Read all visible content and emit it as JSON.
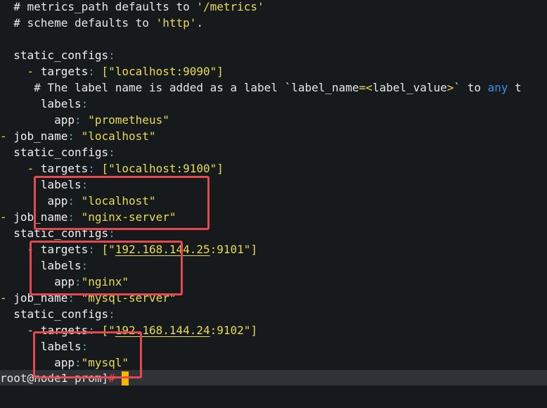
{
  "terminal": {
    "lines": [
      {
        "c1": "  # metrics_path defaults to ",
        "c2": "'/metrics'"
      },
      {
        "c1": "  # scheme defaults to ",
        "c2": "'http'",
        "c3": "."
      },
      {},
      {
        "k": "  static_configs",
        "colon": ":"
      },
      {
        "dash": "    - ",
        "k": "targets",
        "colon": ":",
        "v": " [\"localhost:9090\"]"
      },
      {
        "c1": "     # The label name is added as a label `label_name",
        "eq": "=<",
        "c3": "label_value",
        "gt": ">",
        "c4": "` to ",
        "kw": "any",
        "c5": " t"
      },
      {
        "k": "      labels",
        "colon": ":"
      },
      {
        "k": "        app",
        "colon": ":",
        "v": " \"prometheus\""
      },
      {
        "dash": "- ",
        "k": "job_name",
        "colon": ":",
        "v": " \"localhost\""
      },
      {
        "k": "  static_configs",
        "colon": ":"
      },
      {
        "dash": "    - ",
        "k": "targets",
        "colon": ":",
        "v": " [\"localhost:9100\"]"
      },
      {
        "k": "      labels",
        "colon": ":"
      },
      {
        "k": "       app",
        "colon": ":",
        "v": " \"localhost\""
      },
      {
        "dash": "- ",
        "k": "job_name",
        "colon": ":",
        "v": " \"nginx-server\""
      },
      {
        "k": "  static_configs",
        "colon": ":"
      },
      {
        "dash": "    - ",
        "k": "targets",
        "colon": ":",
        "v1": " [\"",
        "ip": "192.168.144.25",
        "v2": ":9101\"]"
      },
      {
        "k": "      labels",
        "colon": ":"
      },
      {
        "k": "        app",
        "colon": ":",
        "v": "\"nginx\""
      },
      {
        "dash": "- ",
        "k": "job_name",
        "colon": ":",
        "v": " \"mysql-server\""
      },
      {
        "k": "  static_configs",
        "colon": ":"
      },
      {
        "dash": "    - ",
        "k": "targets",
        "colon": ":",
        "v1": " [\"",
        "ip": "192.168.144.24",
        "v2": ":9102\"]"
      },
      {
        "k": "      labels",
        "colon": ":"
      },
      {
        "k": "        app",
        "colon": ":",
        "v": "\"mysql\""
      }
    ],
    "prompt": "root@node1 prom]",
    "prompt_hash": "#",
    "prompt_tail": " "
  },
  "colors": {
    "background": "#171a1d",
    "string": "#e6dc53",
    "colon": "#5f9fb0",
    "keyword": "#3f8fe6",
    "highlight": "#e5484d",
    "cursor": "#f5b800"
  }
}
